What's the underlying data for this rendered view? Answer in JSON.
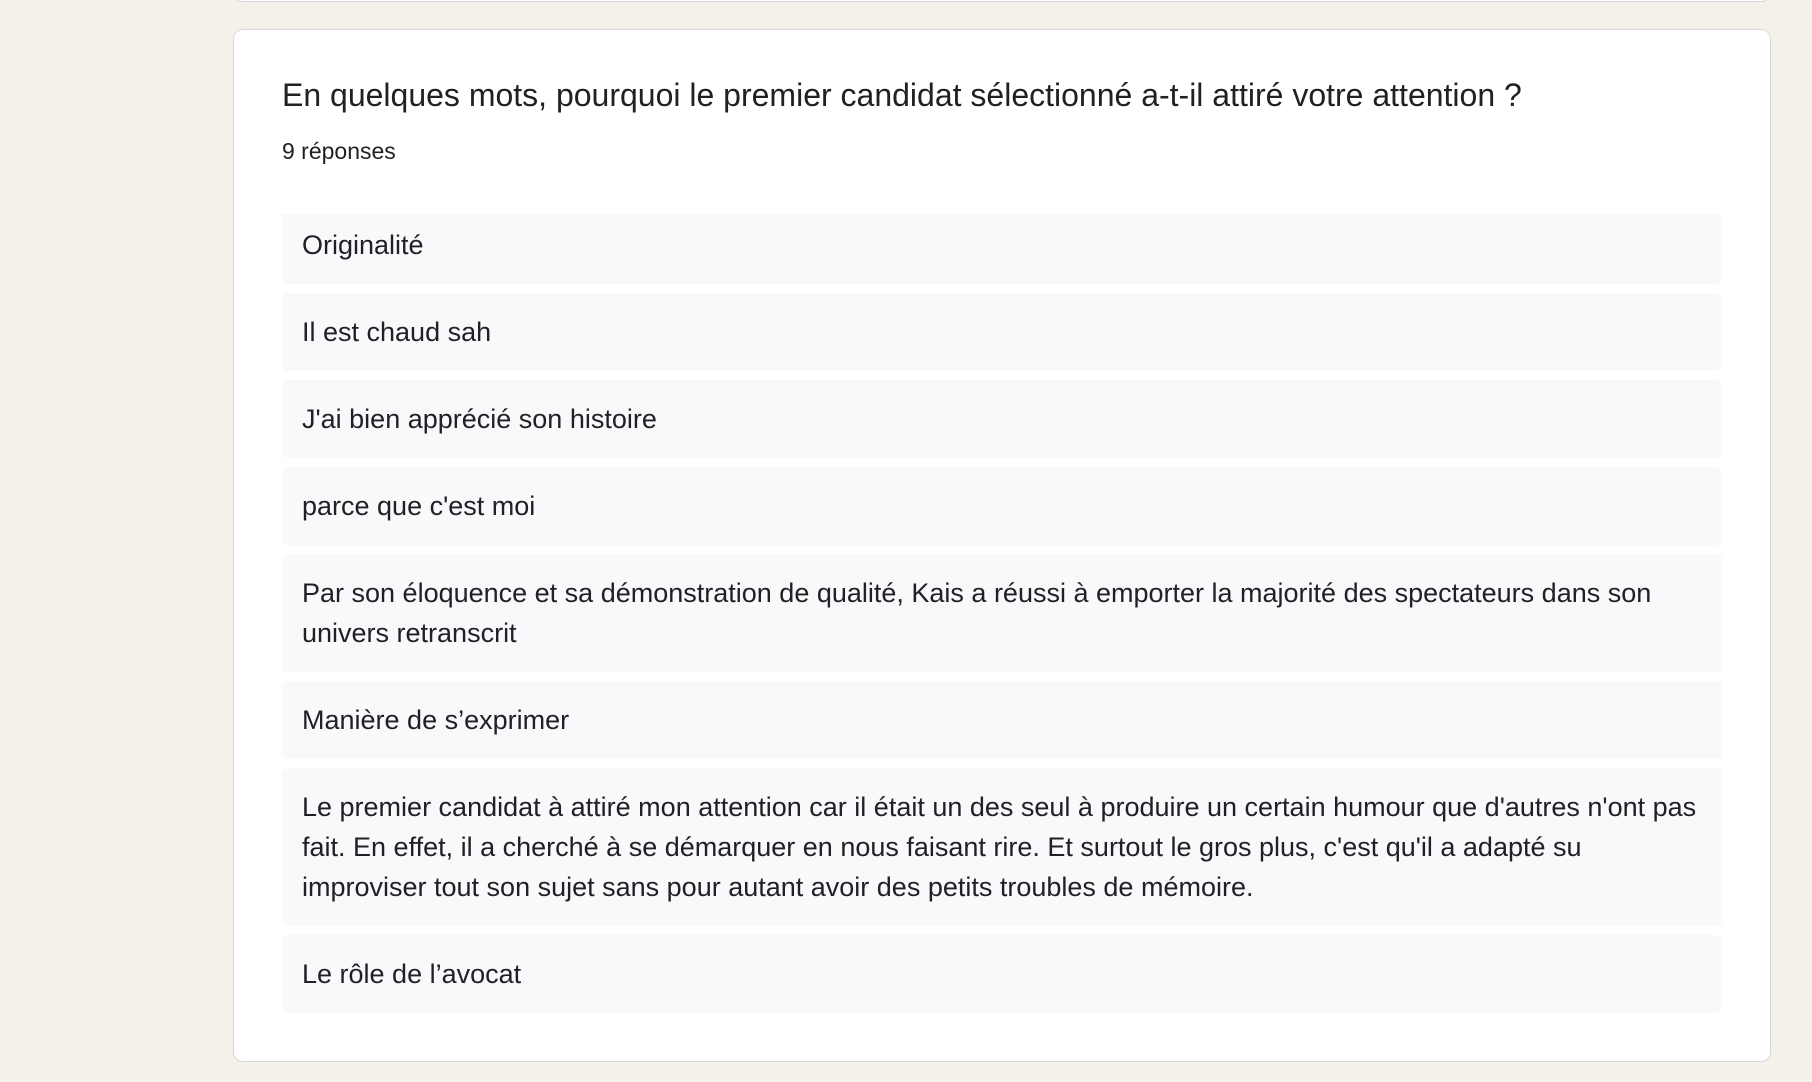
{
  "question": {
    "title": "En quelques mots, pourquoi le premier candidat sélectionné a-t-il attiré votre attention ?",
    "response_count": "9 réponses"
  },
  "responses": [
    "Originalité",
    "Il est chaud sah",
    "J'ai bien apprécié son histoire",
    "parce que c'est moi",
    "Par son éloquence et sa démonstration de qualité, Kais a réussi à emporter la majorité des spectateurs dans son univers retranscrit",
    "Manière de s’exprimer",
    "Le premier candidat à attiré mon attention car il était un des seul à produire un certain humour que d'autres n'ont pas fait. En effet, il a cherché à se démarquer en nous faisant rire. Et surtout le gros plus, c'est qu'il a adapté su improviser tout son sujet sans pour autant avoir des petits troubles de mémoire.",
    "Le rôle de l’avocat"
  ]
}
